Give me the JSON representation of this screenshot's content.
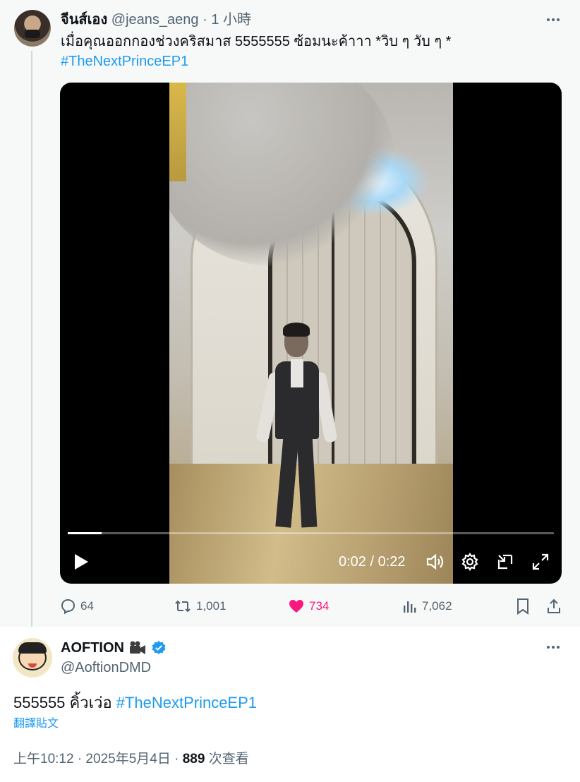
{
  "parent_tweet": {
    "author_name": "จีนส์เอง",
    "handle": "@jeans_aeng",
    "separator": "·",
    "time": "1 小時",
    "text": "เมื่อคุณออกกองช่วงคริสมาส 5555555 ซ้อมนะค้าาา *วิบ ๆ วับ ๆ *",
    "hashtag": "#TheNextPrinceEP1",
    "video": {
      "time_display": "0:02 / 0:22",
      "progress": 0.07
    },
    "actions": {
      "replies": "64",
      "retweets": "1,001",
      "likes": "734",
      "views": "7,062"
    },
    "colors": {
      "like": "#f91880",
      "link": "#1d9bf0",
      "muted": "#536471"
    }
  },
  "reply_tweet": {
    "author_name": "AOFTION",
    "handle": "@AoftionDMD",
    "text": "555555 คิ้วเว่อ",
    "hashtag": "#TheNextPrinceEP1",
    "translate_label": "翻譯貼文",
    "time": "上午10:12 · 2025年5月4日 · ",
    "view_count": "889",
    "view_label": " 次查看",
    "icons": [
      "movie-camera-icon",
      "verified-badge-icon"
    ]
  }
}
